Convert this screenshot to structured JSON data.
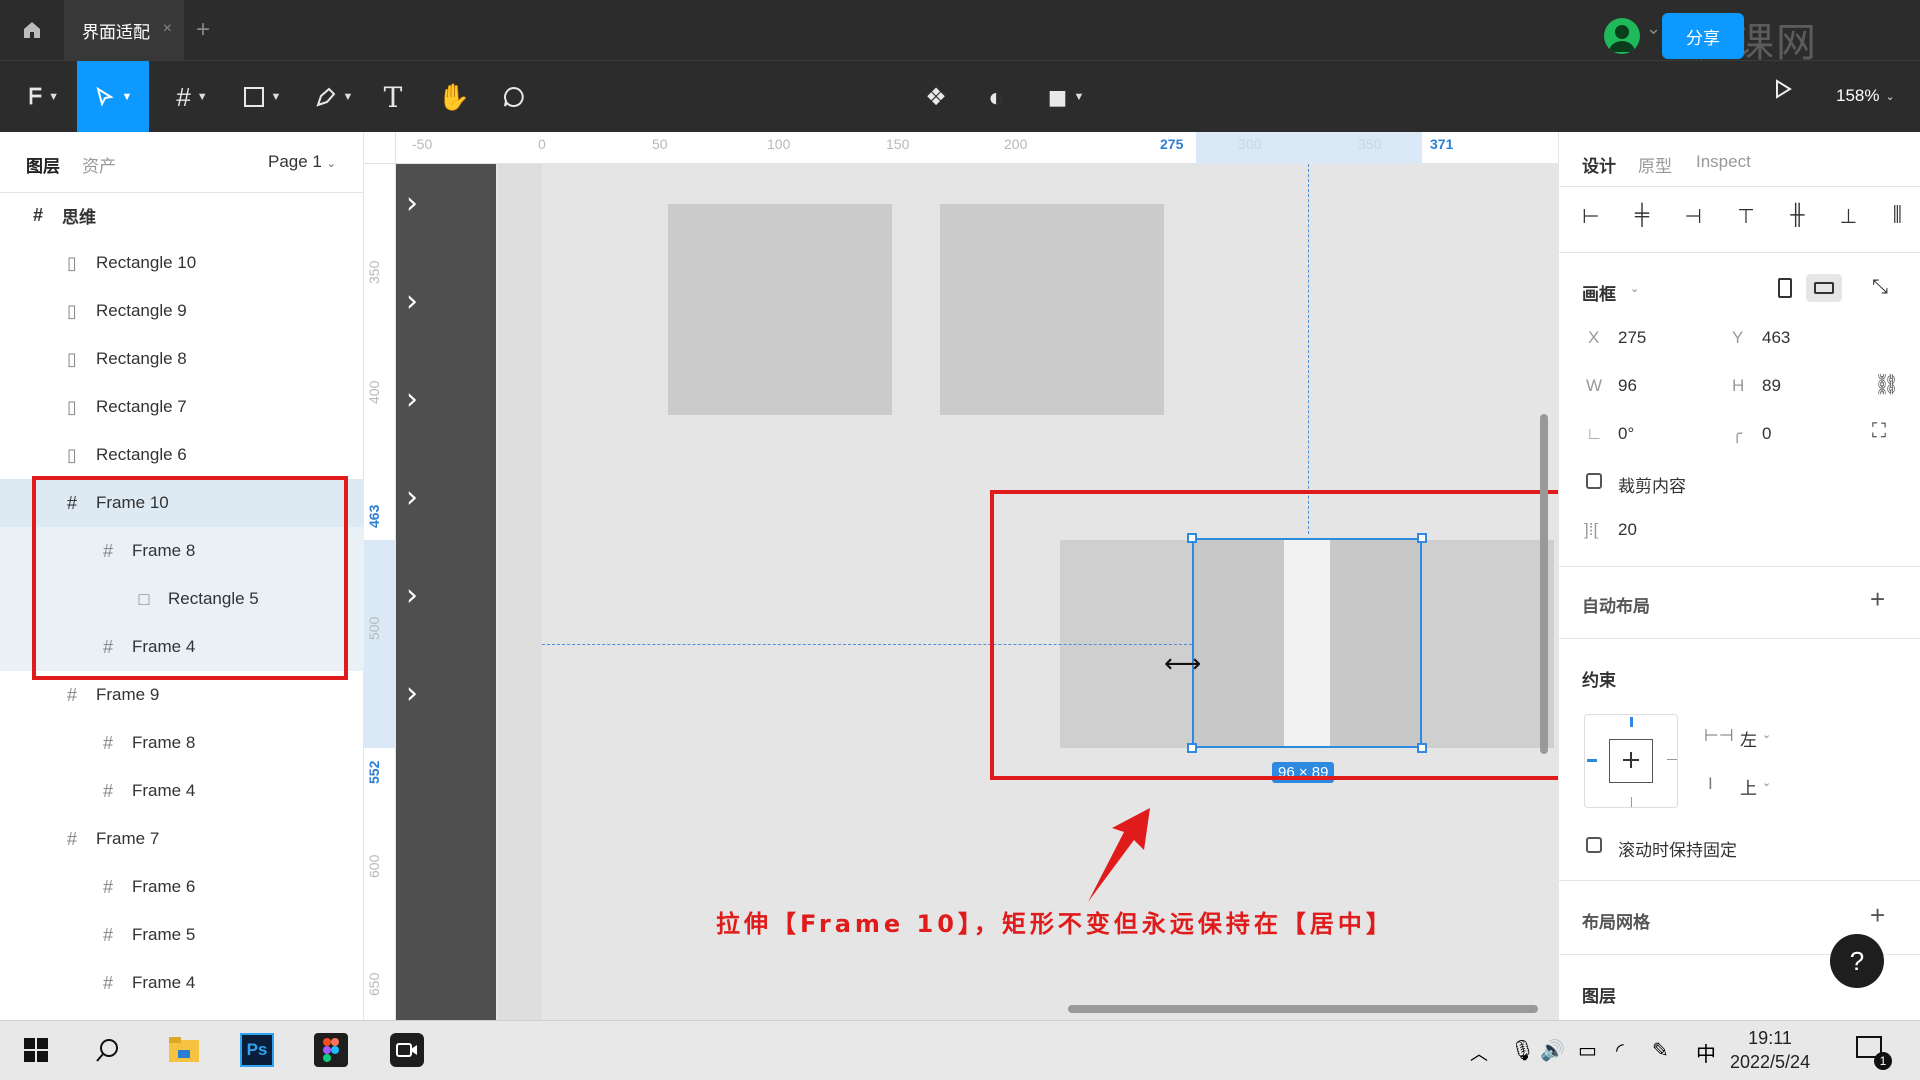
{
  "tabbar": {
    "doc_tab": "界面适配",
    "close": "×",
    "new_tab": "+",
    "watermark": "虎课网"
  },
  "toolbar": {
    "share": "分享",
    "zoom": "158%",
    "colors": {
      "accent": "#0d99ff",
      "bar": "#2c2c2c"
    }
  },
  "left_panel": {
    "tabs": [
      "图层",
      "资产"
    ],
    "page": "Page 1",
    "layers": [
      {
        "name": "思维",
        "type": "frame"
      },
      {
        "name": "Rectangle 10",
        "type": "rect"
      },
      {
        "name": "Rectangle 9",
        "type": "rect"
      },
      {
        "name": "Rectangle 8",
        "type": "rect"
      },
      {
        "name": "Rectangle 7",
        "type": "rect"
      },
      {
        "name": "Rectangle 6",
        "type": "rect"
      },
      {
        "name": "Frame 10",
        "type": "frame"
      },
      {
        "name": "Frame 8",
        "type": "frame"
      },
      {
        "name": "Rectangle 5",
        "type": "rect"
      },
      {
        "name": "Frame 4",
        "type": "frame"
      },
      {
        "name": "Frame 9",
        "type": "frame"
      },
      {
        "name": "Frame 8",
        "type": "frame"
      },
      {
        "name": "Frame 4",
        "type": "frame"
      },
      {
        "name": "Frame 7",
        "type": "frame"
      },
      {
        "name": "Frame 6",
        "type": "frame"
      },
      {
        "name": "Frame 5",
        "type": "frame"
      },
      {
        "name": "Frame 4",
        "type": "frame"
      }
    ]
  },
  "rulers": {
    "top": [
      "-50",
      "0",
      "50",
      "100",
      "150",
      "200",
      "275",
      "300",
      "350",
      "371"
    ],
    "left": [
      "350",
      "400",
      "463",
      "500",
      "552",
      "600",
      "650"
    ]
  },
  "canvas": {
    "size_badge": "96 × 89",
    "annotation": "拉伸【Frame 10】，矩形不变但永远保持在【居中】"
  },
  "right_panel": {
    "tabs": [
      "设计",
      "原型",
      "Inspect"
    ],
    "frame_label": "画框",
    "x_label": "X",
    "x": "275",
    "y_label": "Y",
    "y": "463",
    "w_label": "W",
    "w": "96",
    "h_label": "H",
    "h": "89",
    "rotation": "0°",
    "radius": "0",
    "clip_content": "裁剪内容",
    "spacing": "20",
    "auto_layout": "自动布局",
    "constraints": "约束",
    "constraint_h": "左",
    "constraint_v": "上",
    "fix_scroll": "滚动时保持固定",
    "layout_grid": "布局网格",
    "layer_section": "图层",
    "help": "?"
  },
  "taskbar": {
    "ps": "Ps",
    "ime": "中",
    "time": "19:11",
    "date": "2022/5/24",
    "notif_count": "1"
  }
}
